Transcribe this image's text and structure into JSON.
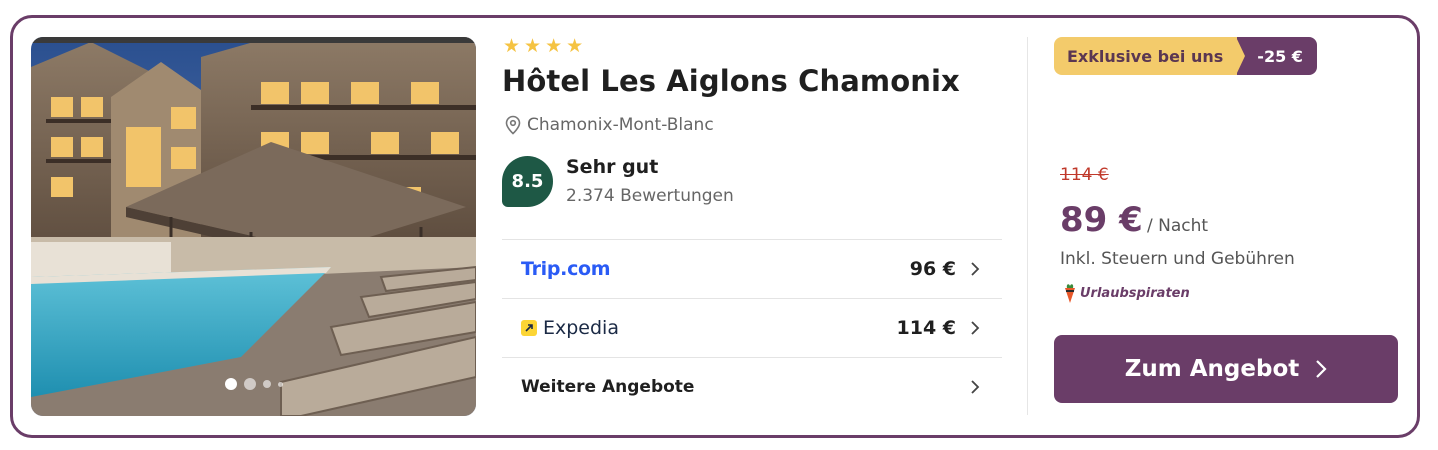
{
  "hotel": {
    "stars": 4,
    "name": "Hôtel Les Aiglons Chamonix",
    "location": "Chamonix-Mont-Blanc",
    "rating_score": "8.5",
    "rating_label": "Sehr gut",
    "review_count": "2.374 Bewertungen"
  },
  "gallery": {
    "image_count": 4,
    "active_index": 0
  },
  "offers": [
    {
      "provider": "Trip.com",
      "price": "96 €"
    },
    {
      "provider": "Expedia",
      "price": "114 €"
    },
    {
      "label": "Weitere Angebote"
    }
  ],
  "deal": {
    "badge_label": "Exklusive bei uns",
    "discount": "-25 €",
    "old_price": "114 €",
    "price": "89 €",
    "per_night": "/ Nacht",
    "tax_note": "Inkl. Steuern und Gebühren",
    "partner": "Urlaubspiraten",
    "cta_label": "Zum Angebot"
  },
  "colors": {
    "brand": "#6a3d68",
    "badge_yellow": "#f3cb6b",
    "rating_green": "#1e5845",
    "old_price_red": "#c0392b",
    "star_yellow": "#f5c342"
  }
}
